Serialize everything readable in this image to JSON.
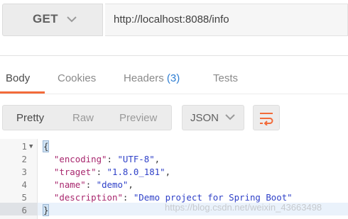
{
  "request": {
    "method": "GET",
    "url": "http://localhost:8088/info"
  },
  "response_tabs": [
    {
      "label": "Body",
      "active": true
    },
    {
      "label": "Cookies"
    },
    {
      "label": "Headers",
      "count": "(3)"
    },
    {
      "label": "Tests"
    }
  ],
  "view_modes": [
    {
      "label": "Pretty",
      "active": true
    },
    {
      "label": "Raw"
    },
    {
      "label": "Preview"
    }
  ],
  "format": {
    "selected": "JSON"
  },
  "icons": {
    "method_dropdown": "chevron-down-icon",
    "format_dropdown": "chevron-down-icon",
    "wrap": "wrap-lines-icon",
    "fold": "fold-arrow-icon"
  },
  "colors": {
    "accent": "#f26b3a",
    "count": "#2d7dd2",
    "json_key": "#a8276e",
    "json_string": "#2f41c8"
  },
  "code": {
    "line_numbers": [
      "1",
      "2",
      "3",
      "4",
      "5",
      "6"
    ],
    "lines": [
      {
        "open": "{"
      },
      {
        "key": "\"encoding\"",
        "value": "\"UTF-8\"",
        "comma": ","
      },
      {
        "key": "\"traget\"",
        "value": "\"1.8.0_181\"",
        "comma": ","
      },
      {
        "key": "\"name\"",
        "value": "\"demo\"",
        "comma": ","
      },
      {
        "key": "\"description\"",
        "value": "\"Demo project for Spring Boot\"",
        "comma": ""
      },
      {
        "close": "}"
      }
    ],
    "colon": ": "
  },
  "watermark": "https://blog.csdn.net/weixin_43663498"
}
